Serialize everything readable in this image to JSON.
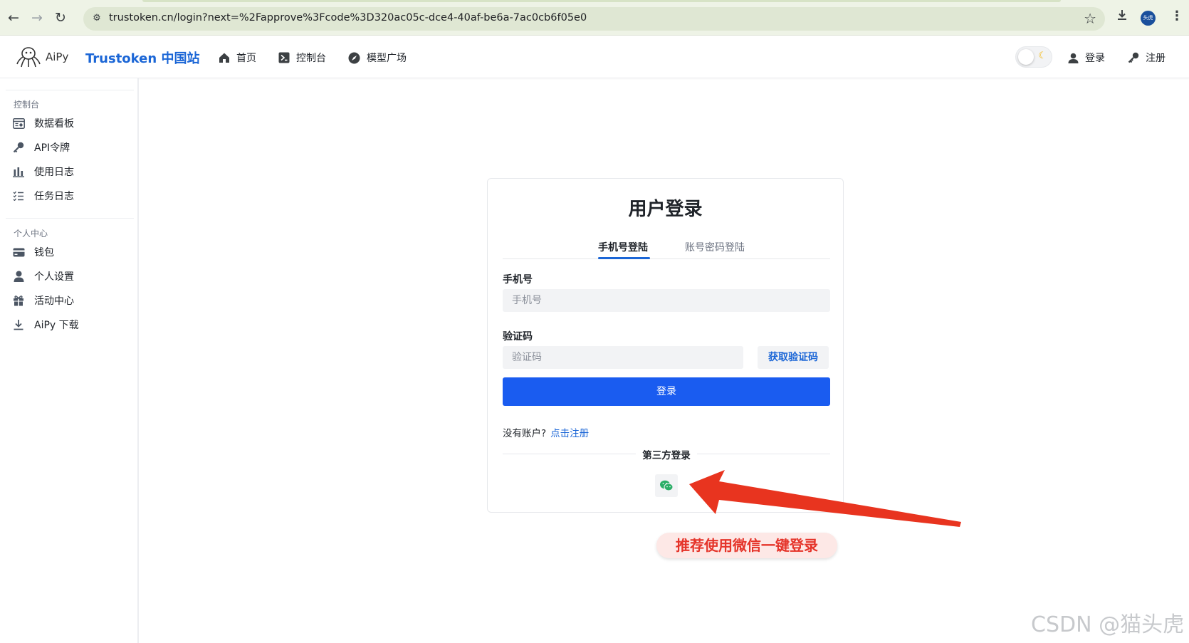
{
  "browser": {
    "url": "trustoken.cn/login?next=%2Fapprove%3Fcode%3D320ac05c-dce4-40af-be6a-7ac0cb6f05e0",
    "profile_label": "头虎"
  },
  "header": {
    "logo_text": "AiPy",
    "brand": "Trustoken 中国站",
    "nav": [
      {
        "label": "首页",
        "icon": "home-icon"
      },
      {
        "label": "控制台",
        "icon": "terminal-icon"
      },
      {
        "label": "模型广场",
        "icon": "compass-icon"
      }
    ],
    "login_label": "登录",
    "register_label": "注册",
    "theme_icon": "moon-icon"
  },
  "sidebar": {
    "section1": "控制台",
    "items1": [
      {
        "label": "数据看板",
        "icon": "dashboard-icon"
      },
      {
        "label": "API令牌",
        "icon": "key-icon"
      },
      {
        "label": "使用日志",
        "icon": "bar-chart-icon"
      },
      {
        "label": "任务日志",
        "icon": "list-icon"
      }
    ],
    "section2": "个人中心",
    "items2": [
      {
        "label": "钱包",
        "icon": "wallet-icon"
      },
      {
        "label": "个人设置",
        "icon": "user-icon"
      },
      {
        "label": "活动中心",
        "icon": "gift-icon"
      },
      {
        "label": "AiPy 下载",
        "icon": "download-icon"
      }
    ]
  },
  "login": {
    "title": "用户登录",
    "tab_active": "手机号登陆",
    "tab_inactive": "账号密码登陆",
    "phone_label": "手机号",
    "phone_placeholder": "手机号",
    "code_label": "验证码",
    "code_placeholder": "验证码",
    "get_code": "获取验证码",
    "submit": "登录",
    "no_account": "没有账户?",
    "register_link": "点击注册",
    "third_party": "第三方登录"
  },
  "annotation": {
    "text": "推荐使用微信一键登录",
    "color": "#e5342a"
  },
  "watermark": "CSDN @猫头虎"
}
